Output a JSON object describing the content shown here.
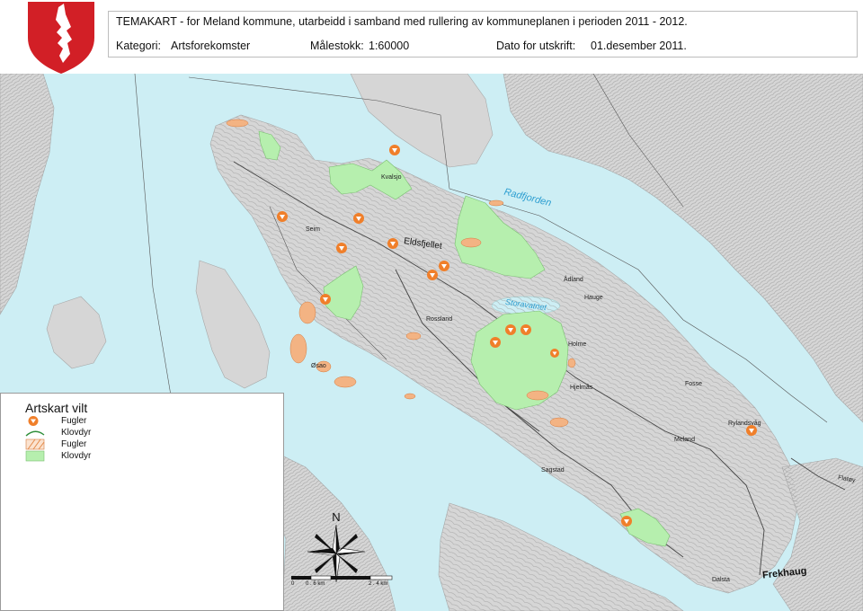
{
  "header": {
    "title": "TEMAKART - for Meland kommune, utarbeidd i samband med rullering av kommuneplanen i perioden 2011 - 2012.",
    "category_label": "Kategori:",
    "category_value": "Artsforekomster",
    "scale_label": "Målestokk:",
    "scale_value": "1:60000",
    "date_label": "Dato for utskrift:",
    "date_value": "01.desember 2011."
  },
  "crest": {
    "name": "Meland kommune coat of arms",
    "colors": {
      "shield": "#d21f26",
      "charge": "#ffffff"
    }
  },
  "legend": {
    "title": "Artskart vilt",
    "items": [
      {
        "symbol": "bird-point-icon",
        "label": "Fugler"
      },
      {
        "symbol": "line-icon",
        "label": "Klovdyr"
      },
      {
        "symbol": "hatched-area-icon",
        "label": "Fugler"
      },
      {
        "symbol": "area-icon",
        "label": "Klovdyr"
      }
    ]
  },
  "map": {
    "colors": {
      "sea": "#cdeef4",
      "land": "#d6d6d6",
      "land_dark": "#bdbdbd",
      "contour": "#8f8f8f",
      "road": "#444444",
      "klovdyr_area": "#b6efae",
      "fugler_area": "#f3b383",
      "fugler_point": "#f07f2a",
      "water_label": "#2e9fd1"
    },
    "place_names": [
      {
        "text": "Radfjorden",
        "kind": "water"
      },
      {
        "text": "Storavatnet",
        "kind": "water"
      },
      {
        "text": "Eldsfjellet",
        "kind": "big"
      },
      {
        "text": "Frekhaug",
        "kind": "town"
      },
      {
        "text": "Flatøy",
        "kind": "small"
      },
      {
        "text": "Øsao",
        "kind": "small"
      },
      {
        "text": "Seim",
        "kind": "small"
      },
      {
        "text": "Holme",
        "kind": "small"
      },
      {
        "text": "Rossland",
        "kind": "small"
      },
      {
        "text": "Hjelmås",
        "kind": "small"
      },
      {
        "text": "Dalsta",
        "kind": "small"
      },
      {
        "text": "Rylandsvåg",
        "kind": "small"
      },
      {
        "text": "Meland",
        "kind": "small"
      },
      {
        "text": "Fosse",
        "kind": "small"
      },
      {
        "text": "Sagstad",
        "kind": "small"
      },
      {
        "text": "Kvalsjo",
        "kind": "small"
      },
      {
        "text": "Hauge",
        "kind": "small"
      },
      {
        "text": "Ådland",
        "kind": "small"
      }
    ],
    "north_label": "N",
    "scale_ticks": [
      "0",
      "0 . 6  km",
      "2 . 4  km"
    ]
  }
}
